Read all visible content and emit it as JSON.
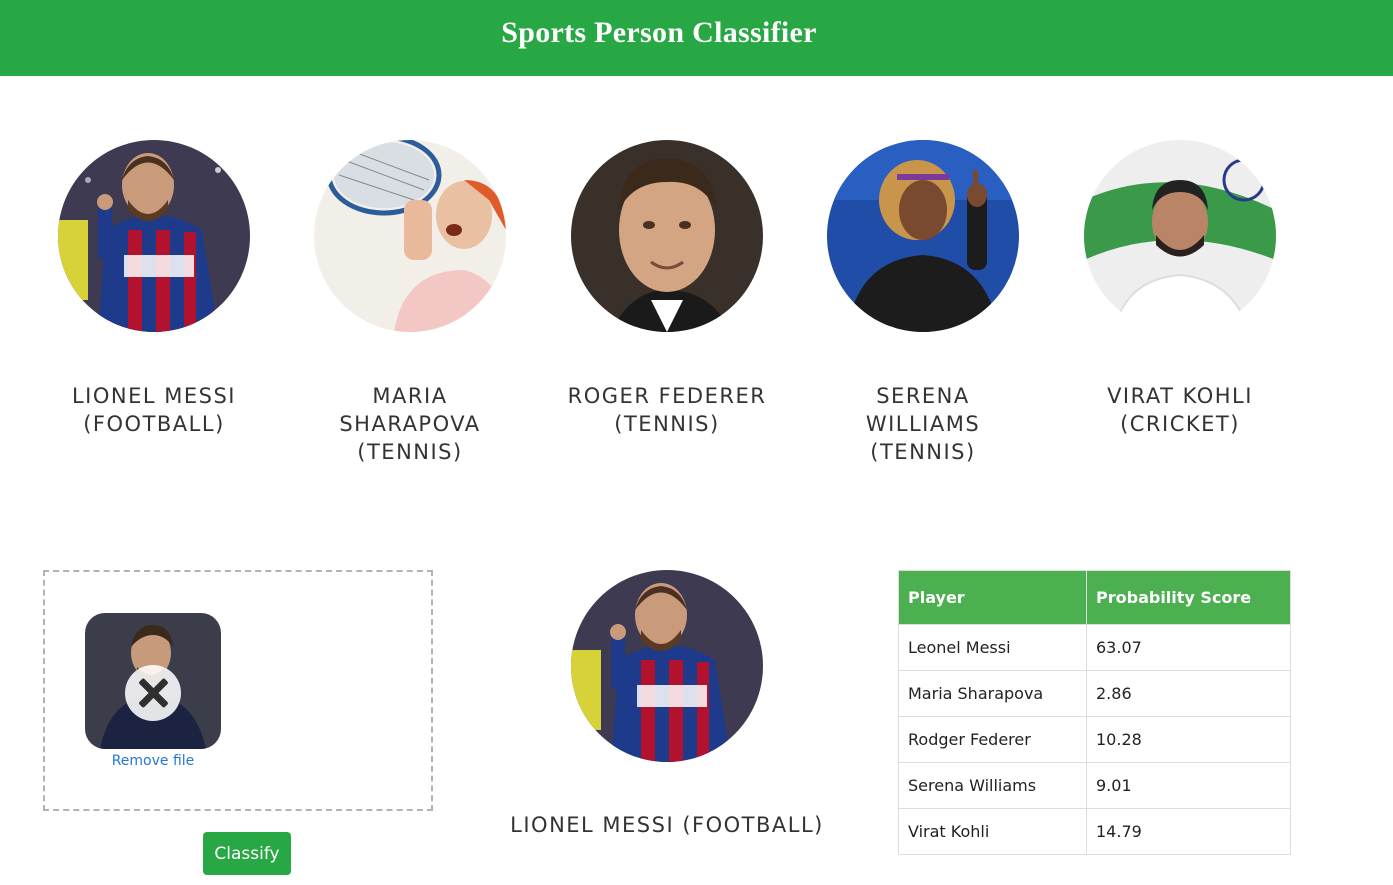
{
  "header": {
    "title": "Sports Person Classifier"
  },
  "players": [
    {
      "name": "Lionel Messi (Football)",
      "photo": "messi-photo"
    },
    {
      "name": "Maria Sharapova (Tennis)",
      "photo": "sharapova-photo"
    },
    {
      "name": "Roger Federer (Tennis)",
      "photo": "federer-photo"
    },
    {
      "name": "Serena Williams (Tennis)",
      "photo": "serena-photo"
    },
    {
      "name": "Virat Kohli (Cricket)",
      "photo": "kohli-photo"
    }
  ],
  "upload": {
    "remove_label": "Remove file",
    "remove_icon": "close-icon",
    "classify_label": "Classify"
  },
  "result": {
    "name": "Lionel Messi (Football)"
  },
  "table": {
    "headers": [
      "Player",
      "Probability Score"
    ],
    "rows": [
      {
        "player": "Leonel Messi",
        "score": "63.07"
      },
      {
        "player": "Maria Sharapova",
        "score": "2.86"
      },
      {
        "player": "Rodger Federer",
        "score": "10.28"
      },
      {
        "player": "Serena Williams",
        "score": "9.01"
      },
      {
        "player": "Virat Kohli",
        "score": "14.79"
      }
    ]
  },
  "colors": {
    "header": "#28a745",
    "table_header": "#4caf50",
    "link": "#2477d3"
  }
}
